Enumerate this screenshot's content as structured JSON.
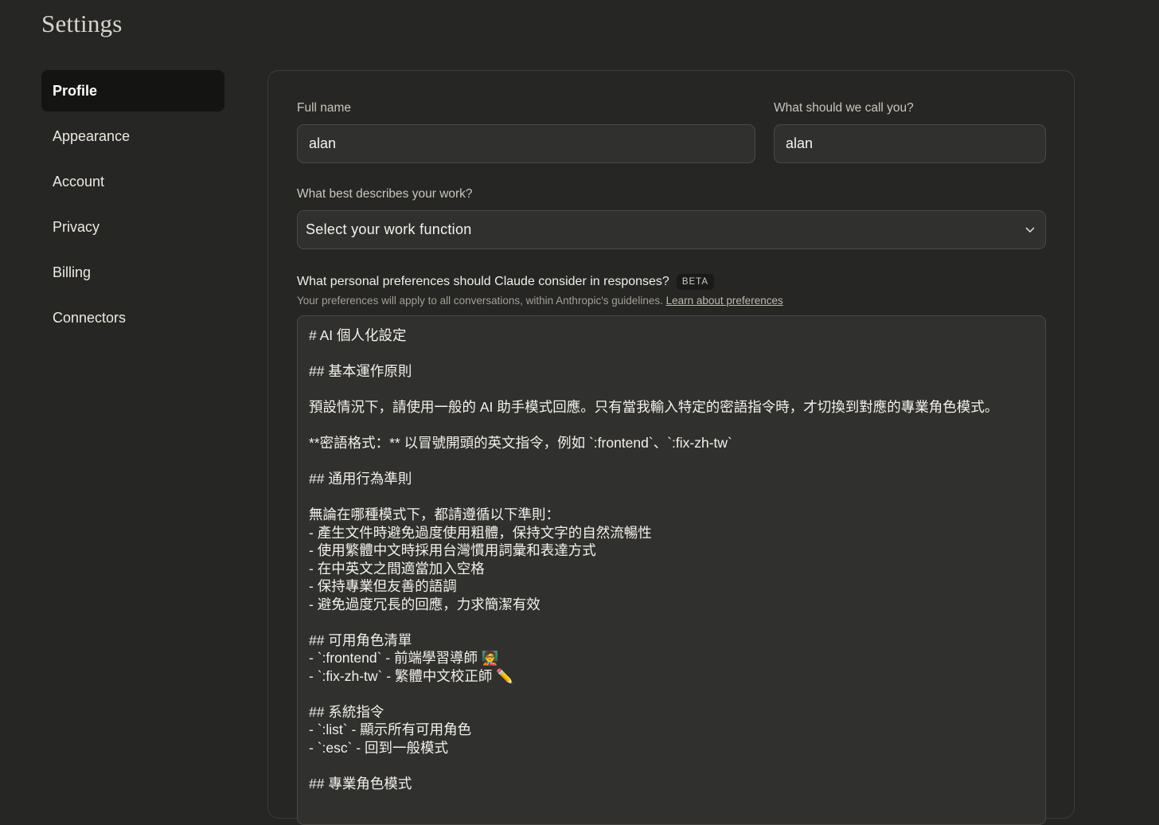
{
  "page": {
    "title": "Settings"
  },
  "sidebar": {
    "items": [
      {
        "label": "Profile",
        "active": true
      },
      {
        "label": "Appearance",
        "active": false
      },
      {
        "label": "Account",
        "active": false
      },
      {
        "label": "Privacy",
        "active": false
      },
      {
        "label": "Billing",
        "active": false
      },
      {
        "label": "Connectors",
        "active": false
      }
    ]
  },
  "profile": {
    "full_name_label": "Full name",
    "full_name_value": "alan",
    "nickname_label": "What should we call you?",
    "nickname_value": "alan",
    "work_label": "What best describes your work?",
    "work_select_value": "Select your work function",
    "work_select_icon": "chevron-down-icon",
    "preferences_question": "What personal preferences should Claude consider in responses?",
    "preferences_badge": "BETA",
    "preferences_sub": "Your preferences will apply to all conversations, within Anthropic's guidelines.",
    "preferences_link": "Learn about preferences",
    "preferences_lines": [
      "# AI 個人化設定",
      "",
      "## 基本運作原則",
      "",
      "預設情況下，請使用一般的 AI 助手模式回應。只有當我輸入特定的密語指令時，才切換到對應的專業角色模式。",
      "",
      "**密語格式：** 以冒號開頭的英文指令，例如 `:frontend`、`:fix-zh-tw`",
      "",
      "## 通用行為準則",
      "",
      "無論在哪種模式下，都請遵循以下準則：",
      "- 產生文件時避免過度使用粗體，保持文字的自然流暢性",
      "- 使用繁體中文時採用台灣慣用詞彙和表達方式",
      "- 在中英文之間適當加入空格",
      "- 保持專業但友善的語調",
      "- 避免過度冗長的回應，力求簡潔有效",
      "",
      "## 可用角色清單",
      "- `:frontend` - 前端學習導師 🧑‍🏫",
      "- `:fix-zh-tw` - 繁體中文校正師 ✏️",
      "",
      "## 系統指令",
      "- `:list` - 顯示所有可用角色",
      "- `:esc` - 回到一般模式",
      "",
      "## 專業角色模式"
    ]
  },
  "colors": {
    "background": "#262624",
    "active_nav": "#141413",
    "input_bg": "#30302e",
    "border": "#4a4945"
  }
}
